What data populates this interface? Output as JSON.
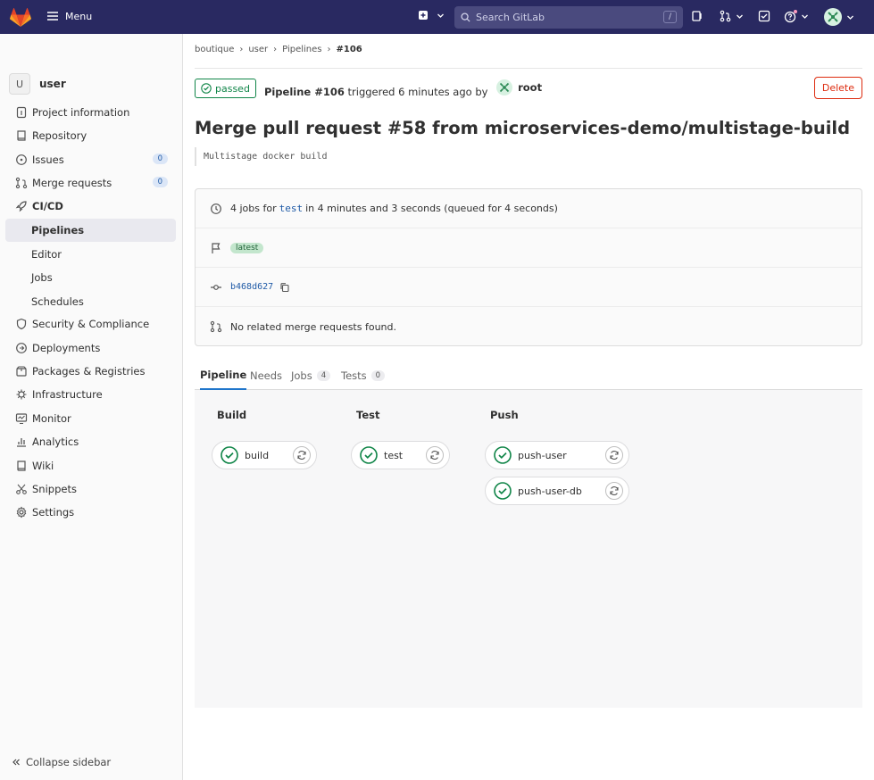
{
  "topbar": {
    "menu_label": "Menu",
    "search_placeholder": "Search GitLab",
    "search_shortcut": "/"
  },
  "sidebar": {
    "project_initial": "U",
    "project_name": "user",
    "items": [
      {
        "label": "Project information"
      },
      {
        "label": "Repository"
      },
      {
        "label": "Issues",
        "count": "0"
      },
      {
        "label": "Merge requests",
        "count": "0"
      },
      {
        "label": "CI/CD"
      },
      {
        "label": "Pipelines"
      },
      {
        "label": "Editor"
      },
      {
        "label": "Jobs"
      },
      {
        "label": "Schedules"
      },
      {
        "label": "Security & Compliance"
      },
      {
        "label": "Deployments"
      },
      {
        "label": "Packages & Registries"
      },
      {
        "label": "Infrastructure"
      },
      {
        "label": "Monitor"
      },
      {
        "label": "Analytics"
      },
      {
        "label": "Wiki"
      },
      {
        "label": "Snippets"
      },
      {
        "label": "Settings"
      }
    ],
    "collapse_label": "Collapse sidebar"
  },
  "breadcrumb": [
    "boutique",
    "user",
    "Pipelines",
    "#106"
  ],
  "header": {
    "status": "passed",
    "pipeline": "Pipeline #106",
    "triggered": "triggered 6 minutes ago by",
    "user": "root",
    "delete_label": "Delete"
  },
  "title": "Merge pull request #58 from microservices-demo/multistage-build",
  "description": "Multistage docker build",
  "info": {
    "jobs_prefix": "4 jobs for",
    "ref": "test",
    "jobs_suffix": "in 4 minutes and 3 seconds (queued for 4 seconds)",
    "tag": "latest",
    "sha": "b468d627",
    "mr_text": "No related merge requests found."
  },
  "tabs": [
    {
      "label": "Pipeline"
    },
    {
      "label": "Needs"
    },
    {
      "label": "Jobs",
      "count": "4"
    },
    {
      "label": "Tests",
      "count": "0"
    }
  ],
  "stages": [
    {
      "name": "Build",
      "jobs": [
        "build"
      ]
    },
    {
      "name": "Test",
      "jobs": [
        "test"
      ]
    },
    {
      "name": "Push",
      "jobs": [
        "push-user",
        "push-user-db"
      ]
    }
  ]
}
